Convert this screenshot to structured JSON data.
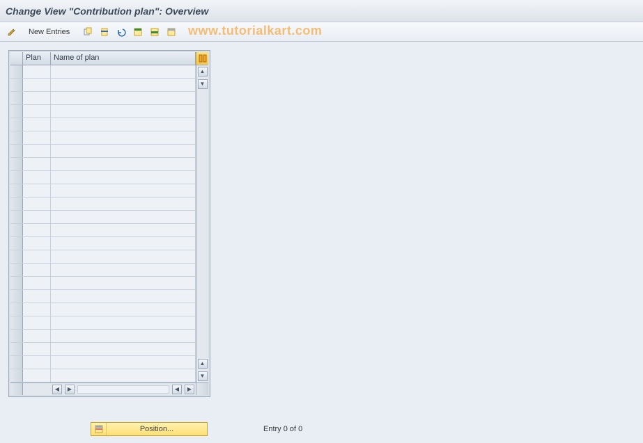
{
  "title": "Change View \"Contribution plan\": Overview",
  "toolbar": {
    "new_entries_label": "New Entries"
  },
  "watermark": "www.tutorialkart.com",
  "grid": {
    "columns": {
      "plan": "Plan",
      "name": "Name of plan"
    },
    "rows": []
  },
  "footer": {
    "position_label": "Position...",
    "entry_text": "Entry 0 of 0"
  }
}
